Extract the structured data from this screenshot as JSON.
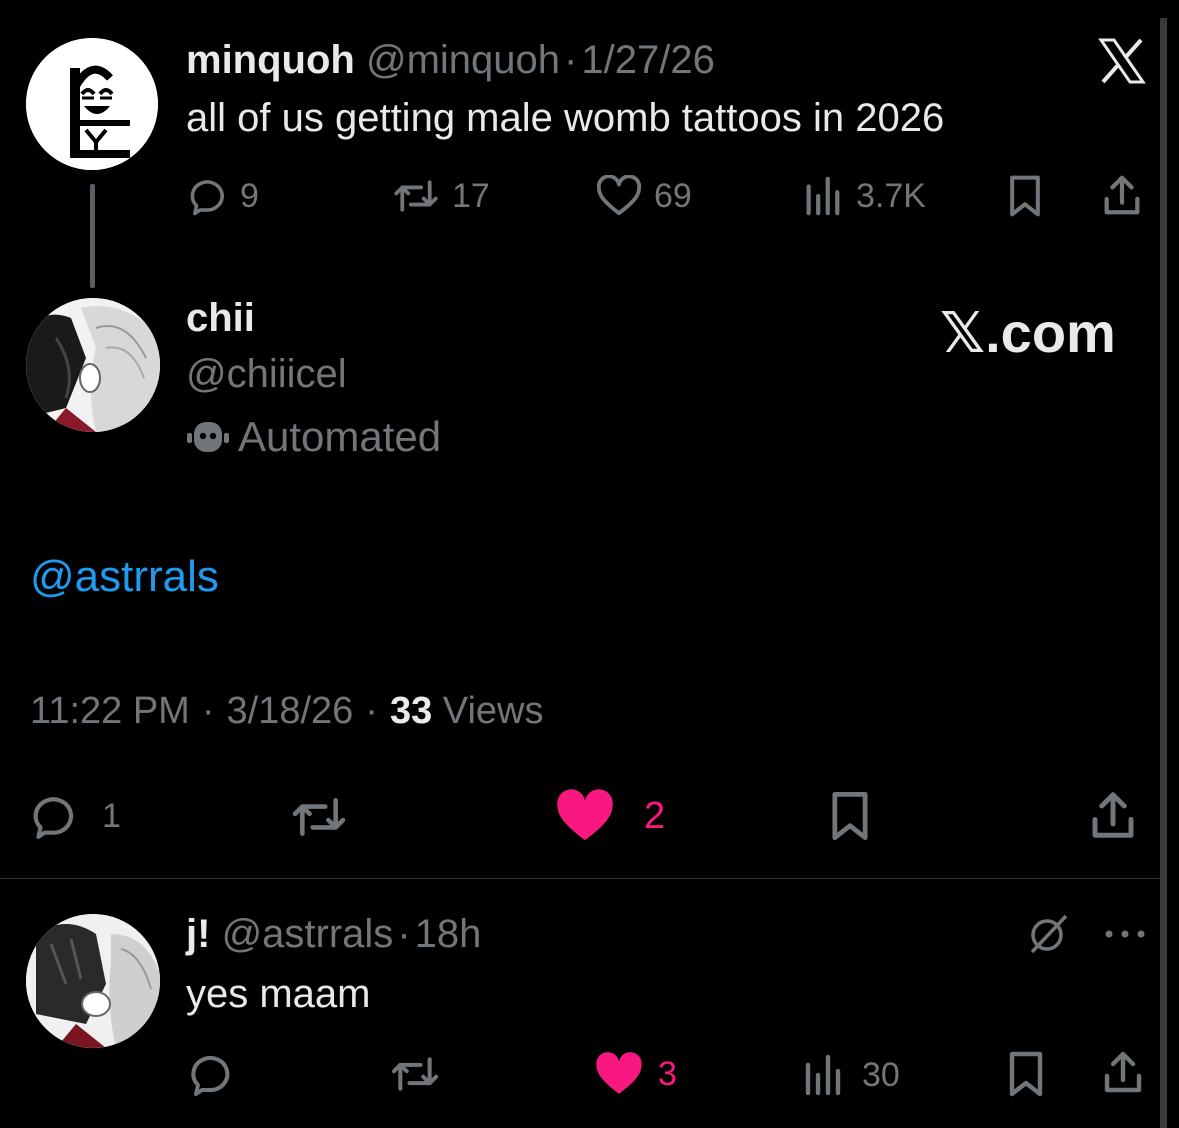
{
  "quoted": {
    "name": "minquoh",
    "handle": "@minquoh",
    "sep": "·",
    "date": "1/27/26",
    "text": "all of us getting male womb tattoos in 2026",
    "replies": "9",
    "reposts": "17",
    "likes": "69",
    "views": "3.7K",
    "platform_icon": "x-logo-icon"
  },
  "main": {
    "name": "chii",
    "handle": "@chiiicel",
    "automated_label": "Automated",
    "brand": "𝕏.com",
    "mention": "@astrrals",
    "time": "11:22 PM",
    "sep1": "·",
    "date": "3/18/26",
    "sep2": "·",
    "views_count": "33",
    "views_label": "Views",
    "replies": "1",
    "likes": "2",
    "like_color": "#f91880",
    "link_color": "#1d9bf0"
  },
  "reply": {
    "name": "j!",
    "handle": "@astrrals",
    "sep": "·",
    "age": "18h",
    "text": "yes maam",
    "likes": "3",
    "views": "30"
  }
}
